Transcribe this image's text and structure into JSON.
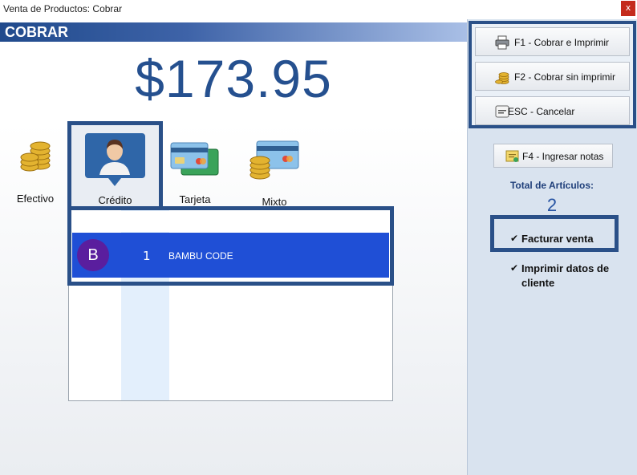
{
  "window": {
    "title": "Venta de Productos: Cobrar",
    "close_label": "x"
  },
  "header": {
    "title": "COBRAR"
  },
  "amount": "$173.95",
  "payment_methods": [
    {
      "label": "Efectivo",
      "icon": "coins-icon"
    },
    {
      "label": "Crédito",
      "icon": "user-icon",
      "selected": true
    },
    {
      "label": "Tarjeta",
      "icon": "credit-cards-icon"
    },
    {
      "label": "Mixto",
      "icon": "mixed-payment-icon"
    }
  ],
  "list": {
    "rows": [
      {
        "initial": "B",
        "qty": "1",
        "name": "BAMBU CODE"
      }
    ]
  },
  "actions": {
    "print": "F1 - Cobrar e Imprimir",
    "no_print": "F2 - Cobrar sin imprimir",
    "cancel": "ESC - Cancelar",
    "notes": "F4 - Ingresar notas"
  },
  "totals": {
    "label": "Total de Artículos:",
    "value": "2"
  },
  "options": {
    "invoice": {
      "label": "Facturar venta",
      "checked": true
    },
    "print_client": {
      "line1": "Imprimir datos de",
      "line2": "cliente",
      "checked": true
    }
  },
  "colors": {
    "accent": "#2a5088",
    "selection": "#1f4fd6",
    "amount": "#25508f"
  }
}
